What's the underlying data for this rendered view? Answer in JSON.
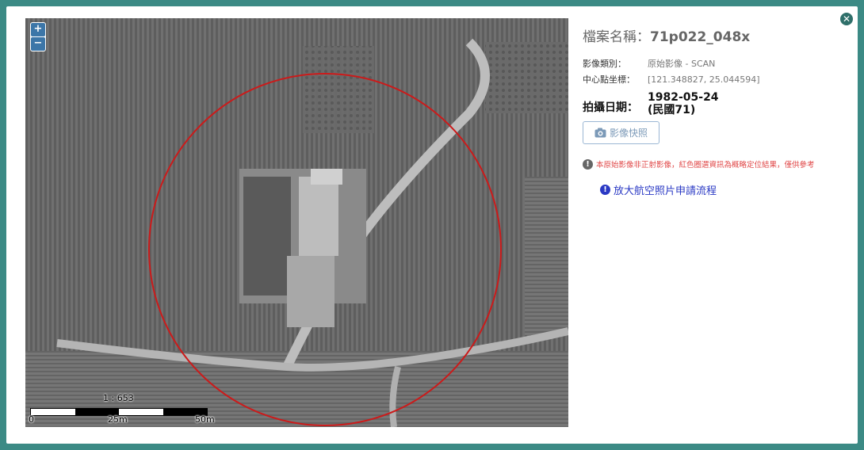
{
  "title": {
    "label": "檔案名稱：",
    "value": "71p022_048x"
  },
  "meta": [
    {
      "key": "影像類別：",
      "value": "原始影像 - SCAN"
    },
    {
      "key": "中心點坐標：",
      "value": "[121.348827, 25.044594]"
    }
  ],
  "date": {
    "label": "拍攝日期：",
    "value": "1982-05-24",
    "roc": "(民國71)"
  },
  "snapshot_button": "影像快照",
  "warning": "本原始影像非正射影像，紅色圈選資訊為概略定位結果，僅供參考",
  "apply_link": "放大航空照片申請流程",
  "map": {
    "zoom_in": "+",
    "zoom_out": "−",
    "scale_ratio": "1 : 653",
    "scale_labels": [
      "0",
      "25m",
      "50m"
    ],
    "circle_color": "#cc1a1a"
  },
  "colors": {
    "frame": "#3c8a85",
    "link": "#2a39c4",
    "warning": "#e04848"
  },
  "icons": {
    "close": "close-icon",
    "camera": "camera-icon",
    "alert": "exclamation-icon",
    "info": "info-icon"
  }
}
